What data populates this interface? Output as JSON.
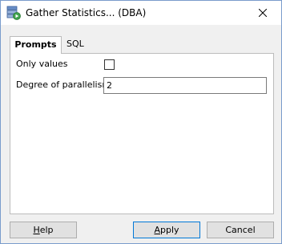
{
  "window": {
    "title": "Gather Statistics... (DBA)"
  },
  "tabs": [
    {
      "label": "Prompts",
      "active": true
    },
    {
      "label": "SQL",
      "active": false
    }
  ],
  "prompts": {
    "only_values_label": "Only values",
    "only_values_checked": false,
    "degree_label": "Degree of parallelism",
    "degree_value": "2"
  },
  "buttons": {
    "help_prefix": "",
    "help_mnemonic": "H",
    "help_rest": "elp",
    "apply_mnemonic": "A",
    "apply_rest": "pply",
    "cancel_label": "Cancel"
  },
  "icons": {
    "window_icon": "gather-statistics-icon",
    "close": "close-icon"
  },
  "colors": {
    "accent": "#0078d7",
    "window_border": "#7a9ccc"
  }
}
